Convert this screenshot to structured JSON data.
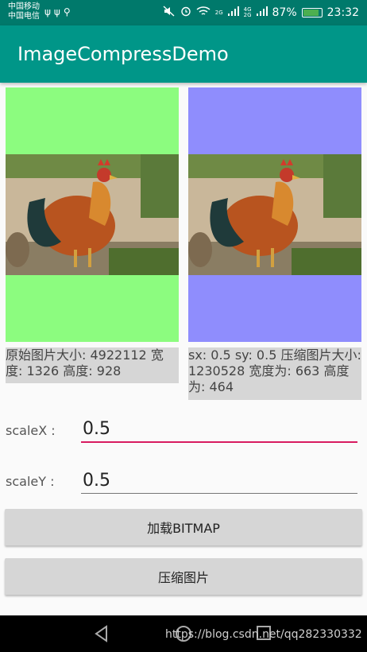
{
  "status_bar": {
    "carrier_line1": "中国移动",
    "carrier_line2": "中国电信",
    "network_small_1": "2G",
    "network_small_2": "4G",
    "network_small_3": "2G",
    "battery_text": "87%",
    "battery_level": 0.87,
    "time": "23:32"
  },
  "app_bar": {
    "title": "ImageCompressDemo"
  },
  "images": {
    "left_background": "#8cfc7f",
    "right_background": "#8f8dfd"
  },
  "info": {
    "original": "原始图片大小: 4922112 宽度: 1326 高度: 928",
    "compressed": " sx: 0.5 sy: 0.5 压缩图片大小: 1230528 宽度为: 663 高度为: 464"
  },
  "form": {
    "scale_x_label": "scaleX :",
    "scale_x_value": "0.5",
    "scale_y_label": "scaleY :",
    "scale_y_value": "0.5"
  },
  "buttons": {
    "load_bitmap": "加载BITMAP",
    "compress": "压缩图片"
  },
  "watermark": "https://blog.csdn.net/qq282330332",
  "colors": {
    "status_bar": "#00796b",
    "primary": "#009688",
    "accent": "#d81b60"
  }
}
